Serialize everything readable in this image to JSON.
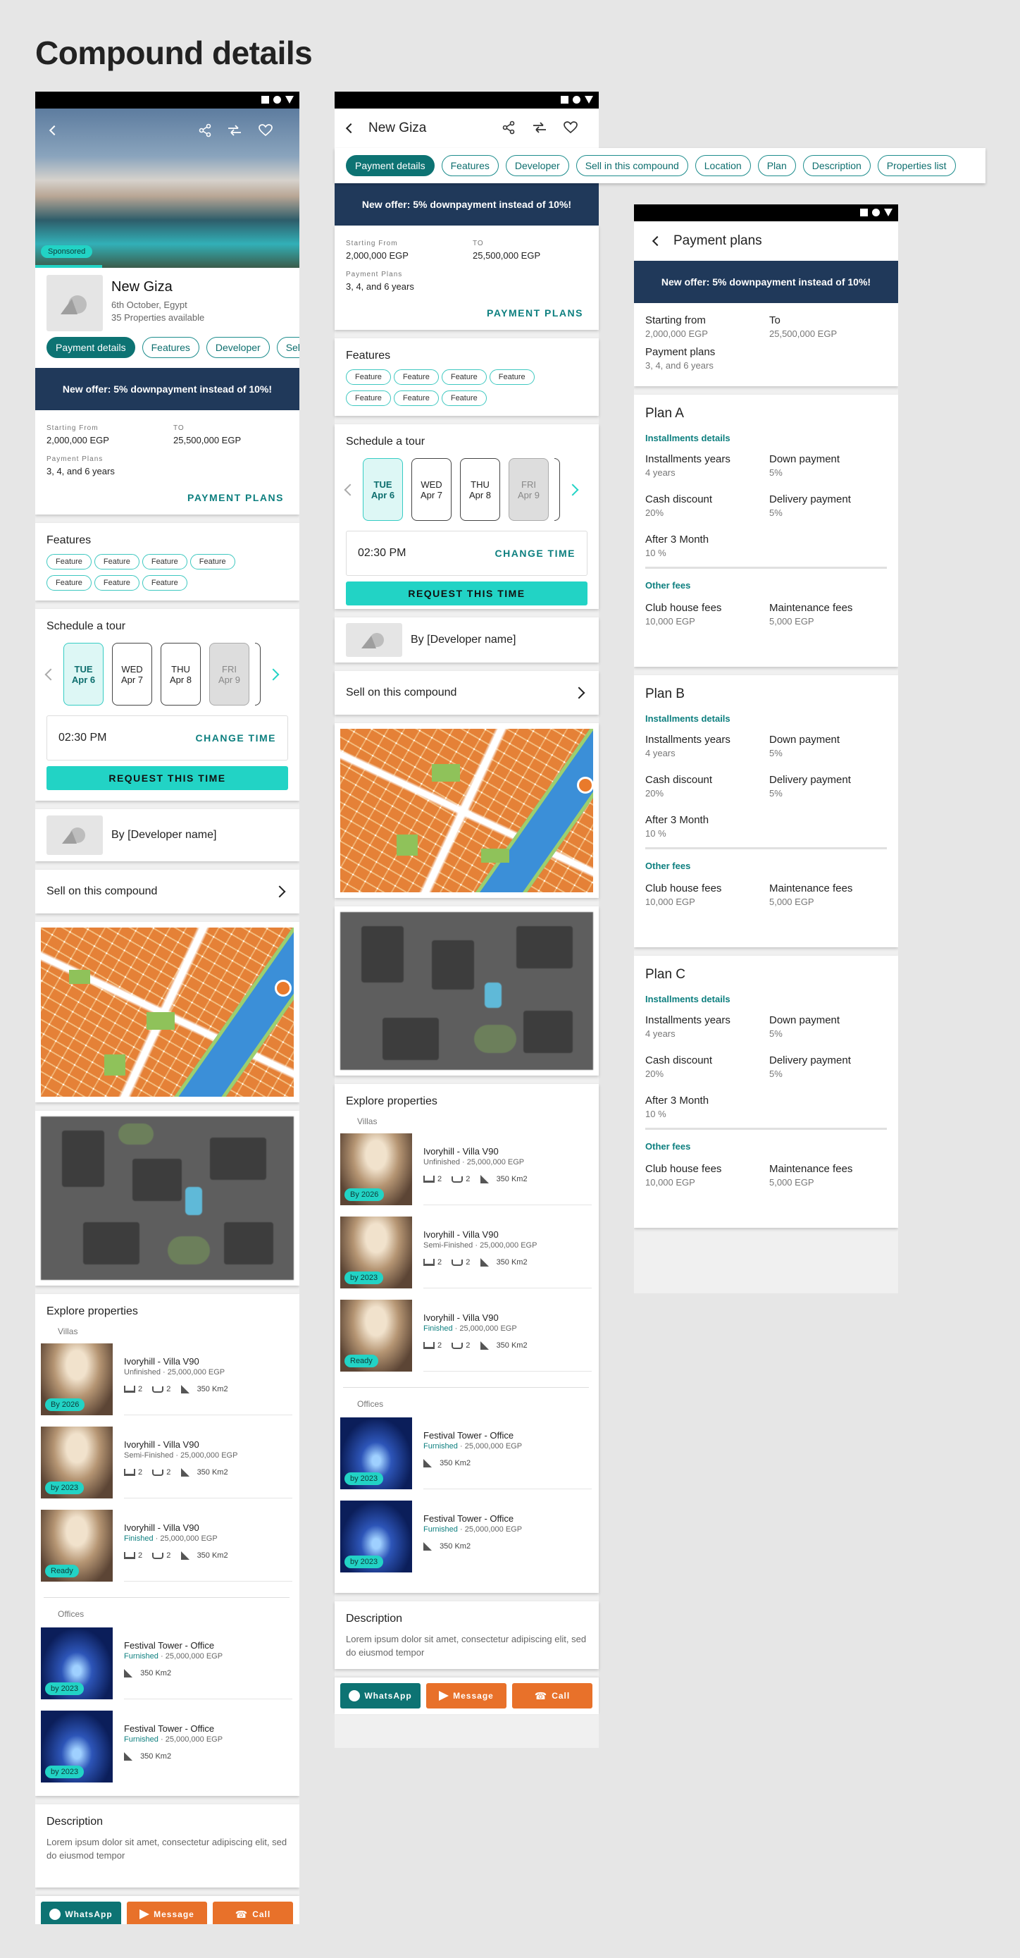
{
  "page_title": "Compound details",
  "compound": {
    "name": "New Giza",
    "location": "6th October, Egypt",
    "properties_count": "35 Properties available",
    "sponsored": "Sponsored"
  },
  "tabs": [
    "Payment details",
    "Features",
    "Developer",
    "Sell in this compound",
    "Location",
    "Plan",
    "Description",
    "Properties list"
  ],
  "offer_text": "New offer: 5% downpayment instead of 10%!",
  "price": {
    "from_label": "Starting From",
    "from_value": "2,000,000 EGP",
    "to_label": "TO",
    "to_value": "25,500,000 EGP",
    "plans_label": "Payment Plans",
    "plans_value": "3, 4, and 6 years",
    "plans_button": "PAYMENT PLANS"
  },
  "features": {
    "title": "Features",
    "items": [
      "Feature",
      "Feature",
      "Feature",
      "Feature",
      "Feature",
      "Feature",
      "Feature"
    ]
  },
  "tour": {
    "title": "Schedule a tour",
    "days_a": [
      {
        "dow": "TUE",
        "date": "Apr 6",
        "state": "sel"
      },
      {
        "dow": "WED",
        "date": "Apr 7",
        "state": ""
      },
      {
        "dow": "THU",
        "date": "Apr 8",
        "state": ""
      },
      {
        "dow": "FRI",
        "date": "Apr 9",
        "state": "dis"
      }
    ],
    "time": "02:30 PM",
    "change_time": "CHANGE TIME",
    "request": "REQUEST THIS TIME"
  },
  "developer": "By [Developer name]",
  "sell": "Sell on this compound",
  "explore": {
    "title": "Explore properties",
    "villas_label": "Villas",
    "offices_label": "Offices",
    "villas": [
      {
        "title": "Ivoryhill - Villa V90",
        "status": "Unfinished",
        "price": "25,000,000 EGP",
        "badge": "By 2026",
        "beds": "2",
        "baths": "2",
        "area": "350 Km2",
        "status_teal": false
      },
      {
        "title": "Ivoryhill - Villa V90",
        "status": "Semi-Finished",
        "price": "25,000,000 EGP",
        "badge": "by 2023",
        "beds": "2",
        "baths": "2",
        "area": "350 Km2",
        "status_teal": false
      },
      {
        "title": "Ivoryhill - Villa V90",
        "status": "Finished",
        "price": "25,000,000 EGP",
        "badge": "Ready",
        "beds": "2",
        "baths": "2",
        "area": "350 Km2",
        "status_teal": true
      }
    ],
    "offices": [
      {
        "title": "Festival Tower - Office",
        "status": "Furnished",
        "price": "25,000,000 EGP",
        "badge": "by 2023",
        "area": "350 Km2"
      },
      {
        "title": "Festival Tower - Office",
        "status": "Furnished",
        "price": "25,000,000 EGP",
        "badge": "by 2023",
        "area": "350 Km2"
      }
    ]
  },
  "description": {
    "title": "Description",
    "text": "Lorem ipsum dolor sit amet, consectetur adipiscing elit, sed do eiusmod tempor"
  },
  "cta": {
    "whatsapp": "WhatsApp",
    "message": "Message",
    "call": "Call"
  },
  "payment_plans": {
    "title": "Payment plans",
    "starting_from": "Starting from",
    "starting_value": "2,000,000 EGP",
    "to": "To",
    "to_value": "25,500,000 EGP",
    "plans_label": "Payment plans",
    "plans_value": "3, 4, and 6 years",
    "installments_details": "Installments details",
    "other_fees": "Other fees",
    "plans": [
      {
        "name": "Plan A",
        "installments_years": "4 years",
        "down_payment": "5%",
        "cash_discount": "20%",
        "delivery_payment": "5%",
        "after": "10 %",
        "club": "10,000 EGP",
        "maintenance": "5,000 EGP"
      },
      {
        "name": "Plan B",
        "installments_years": "4 years",
        "down_payment": "5%",
        "cash_discount": "20%",
        "delivery_payment": "5%",
        "after": "10 %",
        "club": "10,000 EGP",
        "maintenance": "5,000 EGP"
      },
      {
        "name": "Plan C",
        "installments_years": "4 years",
        "down_payment": "5%",
        "cash_discount": "20%",
        "delivery_payment": "5%",
        "after": "10 %",
        "club": "10,000 EGP",
        "maintenance": "5,000 EGP"
      }
    ],
    "labels": {
      "installments_years": "Installments years",
      "down_payment": "Down payment",
      "cash_discount": "Cash discount",
      "delivery_payment": "Delivery payment",
      "after": "After 3 Month",
      "club": "Club house fees",
      "maintenance": "Maintenance fees"
    }
  },
  "colors": {
    "teal": "#0d7373",
    "aqua": "#22d3c5",
    "navy": "#20395a",
    "orange": "#e8712a"
  }
}
